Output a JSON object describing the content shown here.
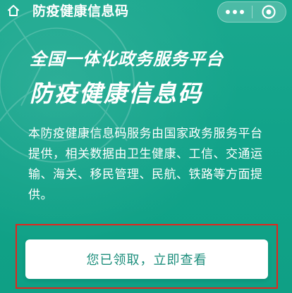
{
  "header": {
    "title": "防疫健康信息码",
    "home_icon": "home-icon",
    "more_icon": "more-dots-icon",
    "close_icon": "target-circle-icon"
  },
  "hero": {
    "subtitle": "全国一体化政务服务平台",
    "headline": "防疫健康信息码"
  },
  "description": "本防疫健康信息码服务由国家政务服务平台提供，相关数据由卫生健康、工信、交通运输、海关、移民管理、民航、铁路等方面提供。",
  "cta": {
    "label": "您已领取，立即查看"
  },
  "colors": {
    "background": "#16a88f",
    "button_text": "#1c8e7c",
    "highlight_frame": "#e5241c"
  }
}
